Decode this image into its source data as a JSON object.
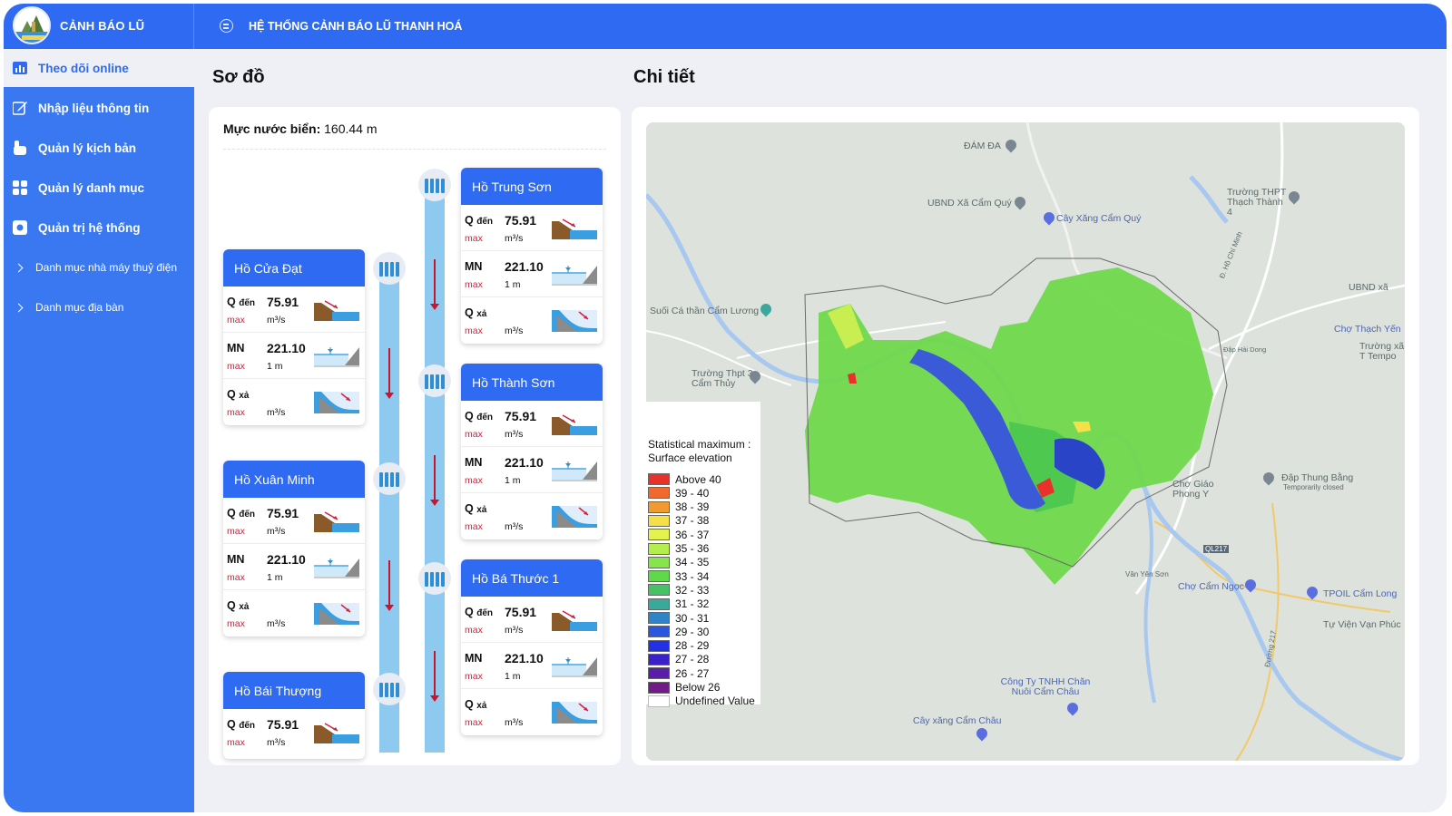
{
  "header": {
    "brand": "CẢNH BÁO LŨ",
    "system_title": "HỆ THỐNG CẢNH BÁO LŨ THANH HOÁ"
  },
  "sidebar": {
    "items": [
      {
        "label": "Theo dõi online",
        "icon": "chart-icon"
      },
      {
        "label": "Nhập liệu thông tin",
        "icon": "edit-icon"
      },
      {
        "label": "Quản lý kịch bản",
        "icon": "hand-icon"
      },
      {
        "label": "Quản lý danh mục",
        "icon": "grid-icon"
      },
      {
        "label": "Quản trị hệ thống",
        "icon": "gear-icon"
      },
      {
        "label": "Danh mục nhà máy thuỷ điện",
        "icon": "chevron-right-icon"
      },
      {
        "label": "Danh mục địa bàn",
        "icon": "chevron-right-icon"
      }
    ]
  },
  "diagram": {
    "title": "Sơ đồ",
    "sea_level_label": "Mực nước biển:",
    "sea_level_value": "160.44 m",
    "labels": {
      "q_in": "Q",
      "q_in_sub": "đến",
      "mn": "MN",
      "q_out": "Q",
      "q_out_sub": "xả",
      "max": "max",
      "flow_unit": "m³/s",
      "level_unit": "1 m"
    },
    "stations": [
      {
        "name": "Hồ Trung Sơn",
        "q_in": "75.91",
        "mn": "221.10"
      },
      {
        "name": "Hồ Thành Sơn",
        "q_in": "75.91",
        "mn": "221.10"
      },
      {
        "name": "Hồ Bá Thước 1",
        "q_in": "75.91",
        "mn": "221.10"
      },
      {
        "name": "Hồ Cửa Đạt",
        "q_in": "75.91",
        "mn": "221.10"
      },
      {
        "name": "Hồ Xuân Minh",
        "q_in": "75.91",
        "mn": "221.10"
      },
      {
        "name": "Hồ Bái Thượng",
        "q_in": "75.91",
        "mn": "221.10"
      }
    ]
  },
  "detail": {
    "title": "Chi tiết",
    "map_labels": [
      "ĐÁM ĐA",
      "UBND Xã Cẩm Quý",
      "Cây Xăng Cẩm Quý",
      "Trường THPT Thạch Thành 4",
      "Suối Cá thần Cẩm Lương",
      "Trường Thpt 3 Cẩm Thủy",
      "UBND xã",
      "Chợ Thạch Yến",
      "Trường xã T Tempo",
      "Chợ Giáo Phong Y",
      "Đập Thung Bằng",
      "Temporarily closed",
      "Chợ Cẩm Ngọc",
      "TPOIL Cẩm Long",
      "Tự Viện Vạn Phúc",
      "Công Ty TNHH Chăn Nuôi Cẩm Châu",
      "Cây xăng Cẩm Châu",
      "QL217",
      "Vân Yên Sơn",
      "Đ. Hồ Chí Minh",
      "Đường 217",
      "Đập Hải Dong"
    ],
    "legend": {
      "title": "Statistical maximum : Surface elevation",
      "items": [
        {
          "label": "Above 40",
          "color": "#e8312a"
        },
        {
          "label": "39 - 40",
          "color": "#ef6a2c"
        },
        {
          "label": "38 - 39",
          "color": "#f29a32"
        },
        {
          "label": "37 - 38",
          "color": "#f6e04a"
        },
        {
          "label": "36 - 37",
          "color": "#e4f24d"
        },
        {
          "label": "35 - 36",
          "color": "#b4ee4c"
        },
        {
          "label": "34 - 35",
          "color": "#84e64a"
        },
        {
          "label": "33 - 34",
          "color": "#5fd84c"
        },
        {
          "label": "32 - 33",
          "color": "#46c266"
        },
        {
          "label": "31 - 32",
          "color": "#3aa89a"
        },
        {
          "label": "30 - 31",
          "color": "#3282c6"
        },
        {
          "label": "29 - 30",
          "color": "#2a56e0"
        },
        {
          "label": "28 - 29",
          "color": "#2230e8"
        },
        {
          "label": "27 - 28",
          "color": "#3a22c8"
        },
        {
          "label": "26 - 27",
          "color": "#5a1ea8"
        },
        {
          "label": "Below 26",
          "color": "#721a8a"
        },
        {
          "label": "Undefined Value",
          "color": "#ffffff"
        }
      ]
    }
  }
}
